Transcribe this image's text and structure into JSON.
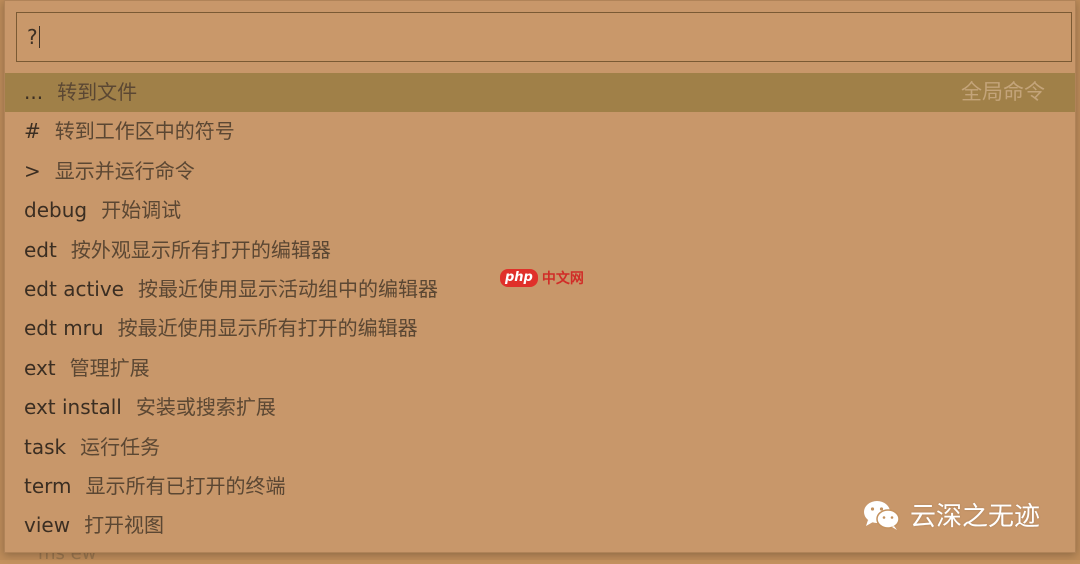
{
  "input": {
    "value": "?"
  },
  "items": [
    {
      "prefix": "...",
      "desc": "转到文件",
      "hint": "全局命令",
      "selected": true
    },
    {
      "prefix": "#",
      "desc": "转到工作区中的符号"
    },
    {
      "prefix": ">",
      "desc": "显示并运行命令"
    },
    {
      "prefix": "debug",
      "desc": "开始调试"
    },
    {
      "prefix": "edt",
      "desc": "按外观显示所有打开的编辑器"
    },
    {
      "prefix": "edt active",
      "desc": "按最近使用显示活动组中的编辑器"
    },
    {
      "prefix": "edt mru",
      "desc": "按最近使用显示所有打开的编辑器"
    },
    {
      "prefix": "ext",
      "desc": "管理扩展"
    },
    {
      "prefix": "ext install",
      "desc": "安装或搜索扩展"
    },
    {
      "prefix": "task",
      "desc": "运行任务"
    },
    {
      "prefix": "term",
      "desc": "显示所有已打开的终端"
    },
    {
      "prefix": "view",
      "desc": "打开视图"
    }
  ],
  "background_text": "ms   ew",
  "watermarks": {
    "php_logo": "php",
    "php_text": "中文网",
    "wechat_label": "云深之无迹"
  },
  "colors": {
    "panel": "#c8976a",
    "selected_row": "#a08048",
    "input_border": "#7a5a34",
    "text": "#3b2e22"
  }
}
